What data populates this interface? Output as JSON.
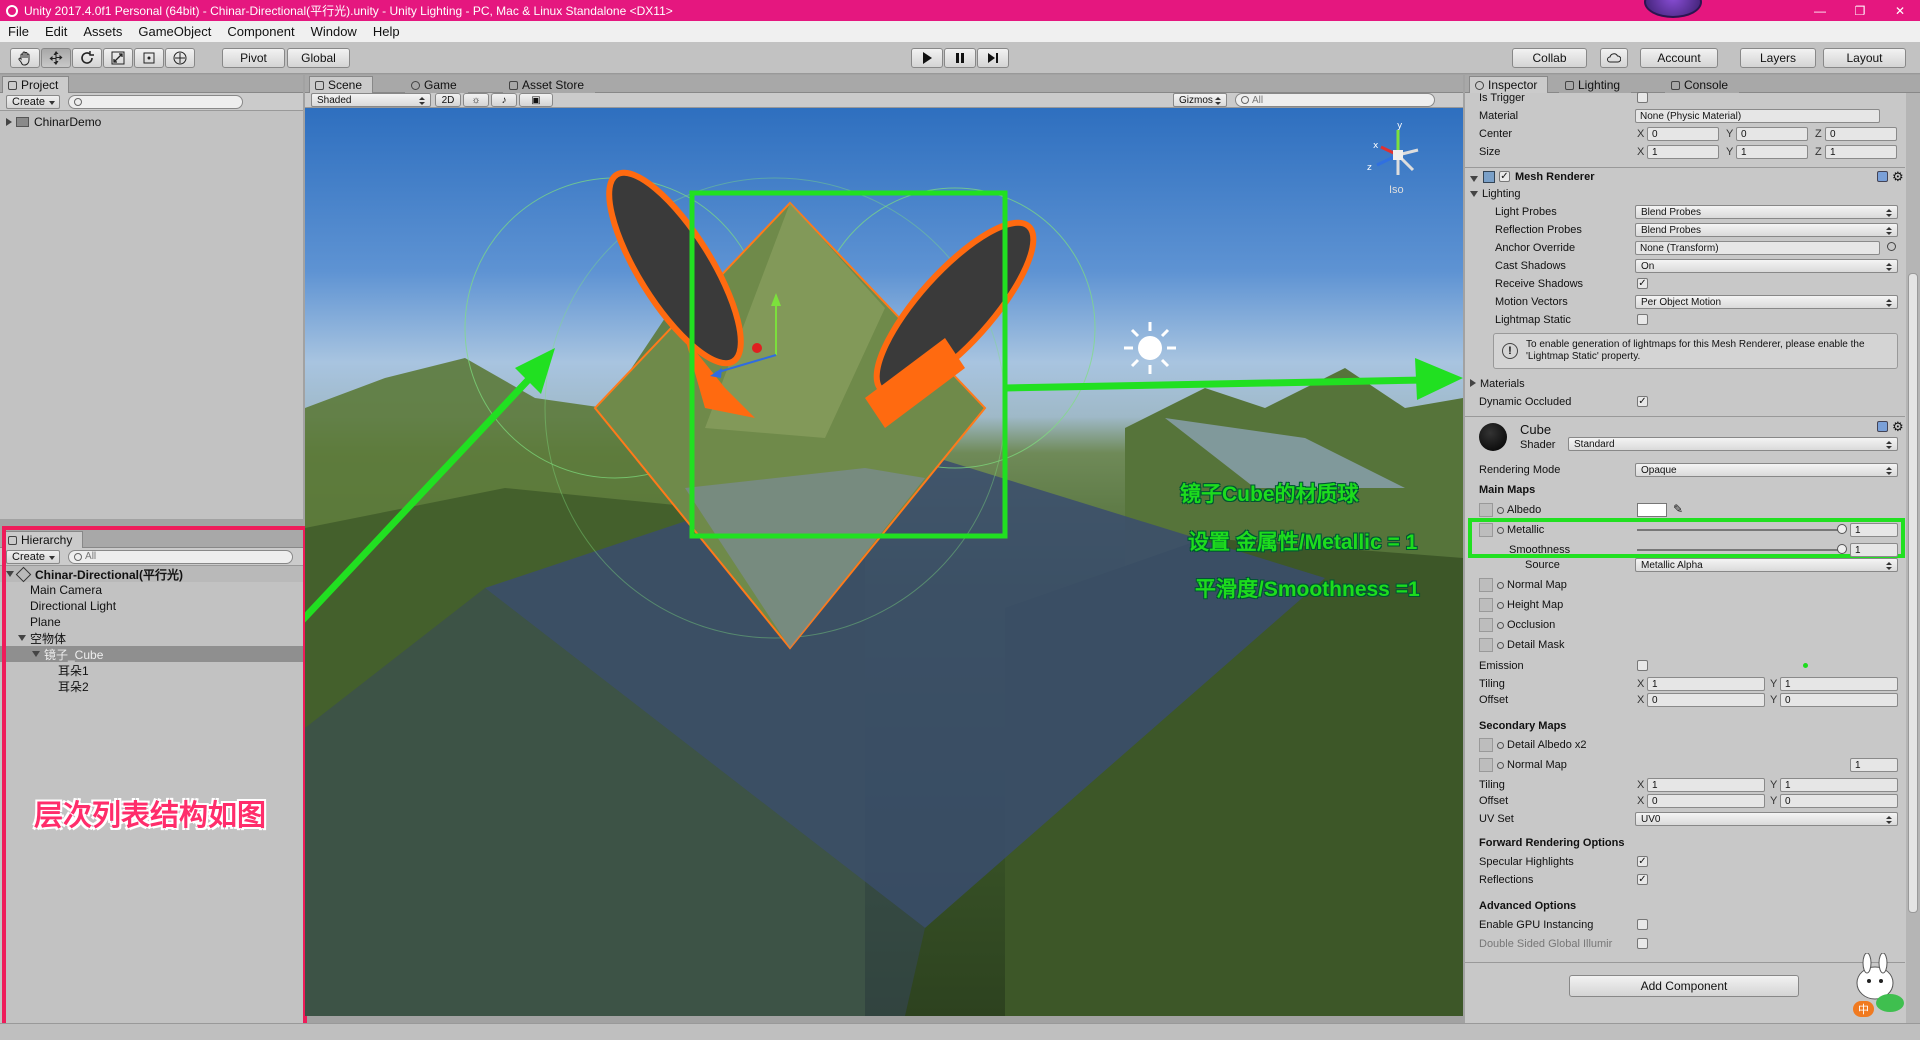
{
  "window": {
    "title": "Unity 2017.4.0f1 Personal (64bit) - Chinar-Directional(平行光).unity - Unity Lighting - PC, Mac & Linux Standalone <DX11>",
    "controls": [
      "—",
      "❐",
      "✕"
    ]
  },
  "menu": [
    "File",
    "Edit",
    "Assets",
    "GameObject",
    "Component",
    "Window",
    "Help"
  ],
  "toolbar": {
    "pivot": "Pivot",
    "global": "Global",
    "collab": "Collab",
    "account": "Account",
    "layers": "Layers",
    "layout": "Layout"
  },
  "project": {
    "tab": "Project",
    "create": "Create",
    "root": "ChinarDemo"
  },
  "hierarchy": {
    "tab": "Hierarchy",
    "create": "Create",
    "search_placeholder": "All",
    "scene": "Chinar-Directional(平行光)",
    "items": [
      "Main Camera",
      "Directional Light",
      "Plane",
      "空物体",
      "镜子_Cube",
      "耳朵1",
      "耳朵2"
    ]
  },
  "scene_tabs": [
    "Scene",
    "Game",
    "Asset Store"
  ],
  "scene_bar": {
    "shading": "Shaded",
    "mode2d": "2D",
    "gizmos": "Gizmos",
    "search_placeholder": "All"
  },
  "gizmo": {
    "iso": "Iso",
    "axis_x": "x",
    "axis_y": "y",
    "axis_z": "z"
  },
  "annotations": {
    "hierarchy_note": "层次列表结构如图",
    "material_note": "镜子Cube的材质球",
    "metallic_note": "设置 金属性/Metallic = 1",
    "smooth_note": "平滑度/Smoothness =1"
  },
  "inspector": {
    "tabs": [
      "Inspector",
      "Lighting",
      "Console"
    ],
    "collider": {
      "is_trigger": "Is Trigger",
      "material_label": "Material",
      "material_value": "None (Physic Material)",
      "center_label": "Center",
      "center": [
        "0",
        "0",
        "0"
      ],
      "size_label": "Size",
      "size": [
        "1",
        "1",
        "1"
      ]
    },
    "mesh_renderer": {
      "title": "Mesh Renderer",
      "lighting": "Lighting",
      "light_probes": "Light Probes",
      "light_probes_value": "Blend Probes",
      "reflection_probes": "Reflection Probes",
      "reflection_probes_value": "Blend Probes",
      "anchor_override": "Anchor Override",
      "anchor_override_value": "None (Transform)",
      "cast_shadows": "Cast Shadows",
      "cast_shadows_value": "On",
      "receive_shadows": "Receive Shadows",
      "motion_vectors": "Motion Vectors",
      "motion_vectors_value": "Per Object Motion",
      "lightmap_static": "Lightmap Static",
      "info": "To enable generation of lightmaps for this Mesh Renderer, please enable the 'Lightmap Static' property.",
      "materials": "Materials",
      "dynamic_occluded": "Dynamic Occluded"
    },
    "material": {
      "name": "Cube",
      "shader_label": "Shader",
      "shader_value": "Standard",
      "rendering_mode": "Rendering Mode",
      "rendering_mode_value": "Opaque",
      "main_maps": "Main Maps",
      "albedo": "Albedo",
      "metallic": "Metallic",
      "metallic_value": "1",
      "metallic_fraction": 1.0,
      "smoothness": "Smoothness",
      "smoothness_value": "1",
      "smoothness_fraction": 1.0,
      "source": "Source",
      "source_value": "Metallic Alpha",
      "normal_map": "Normal Map",
      "height_map": "Height Map",
      "occlusion": "Occlusion",
      "detail_mask": "Detail Mask",
      "emission": "Emission",
      "tiling": "Tiling",
      "offset": "Offset",
      "tiling_values": [
        "1",
        "1"
      ],
      "offset_values": [
        "0",
        "0"
      ],
      "secondary_maps": "Secondary Maps",
      "detail_albedo": "Detail Albedo x2",
      "normal_map2": "Normal Map",
      "normal_map2_value": "1",
      "tiling2_values": [
        "1",
        "1"
      ],
      "offset2_values": [
        "0",
        "0"
      ],
      "uv_set": "UV Set",
      "uv_set_value": "UV0",
      "forward_rendering": "Forward Rendering Options",
      "specular_highlights": "Specular Highlights",
      "reflections": "Reflections",
      "advanced": "Advanced Options",
      "gpu_instancing": "Enable GPU Instancing",
      "double_sided": "Double Sided Global Illumir"
    },
    "add_component": "Add Component"
  },
  "watermark_badge": "中"
}
